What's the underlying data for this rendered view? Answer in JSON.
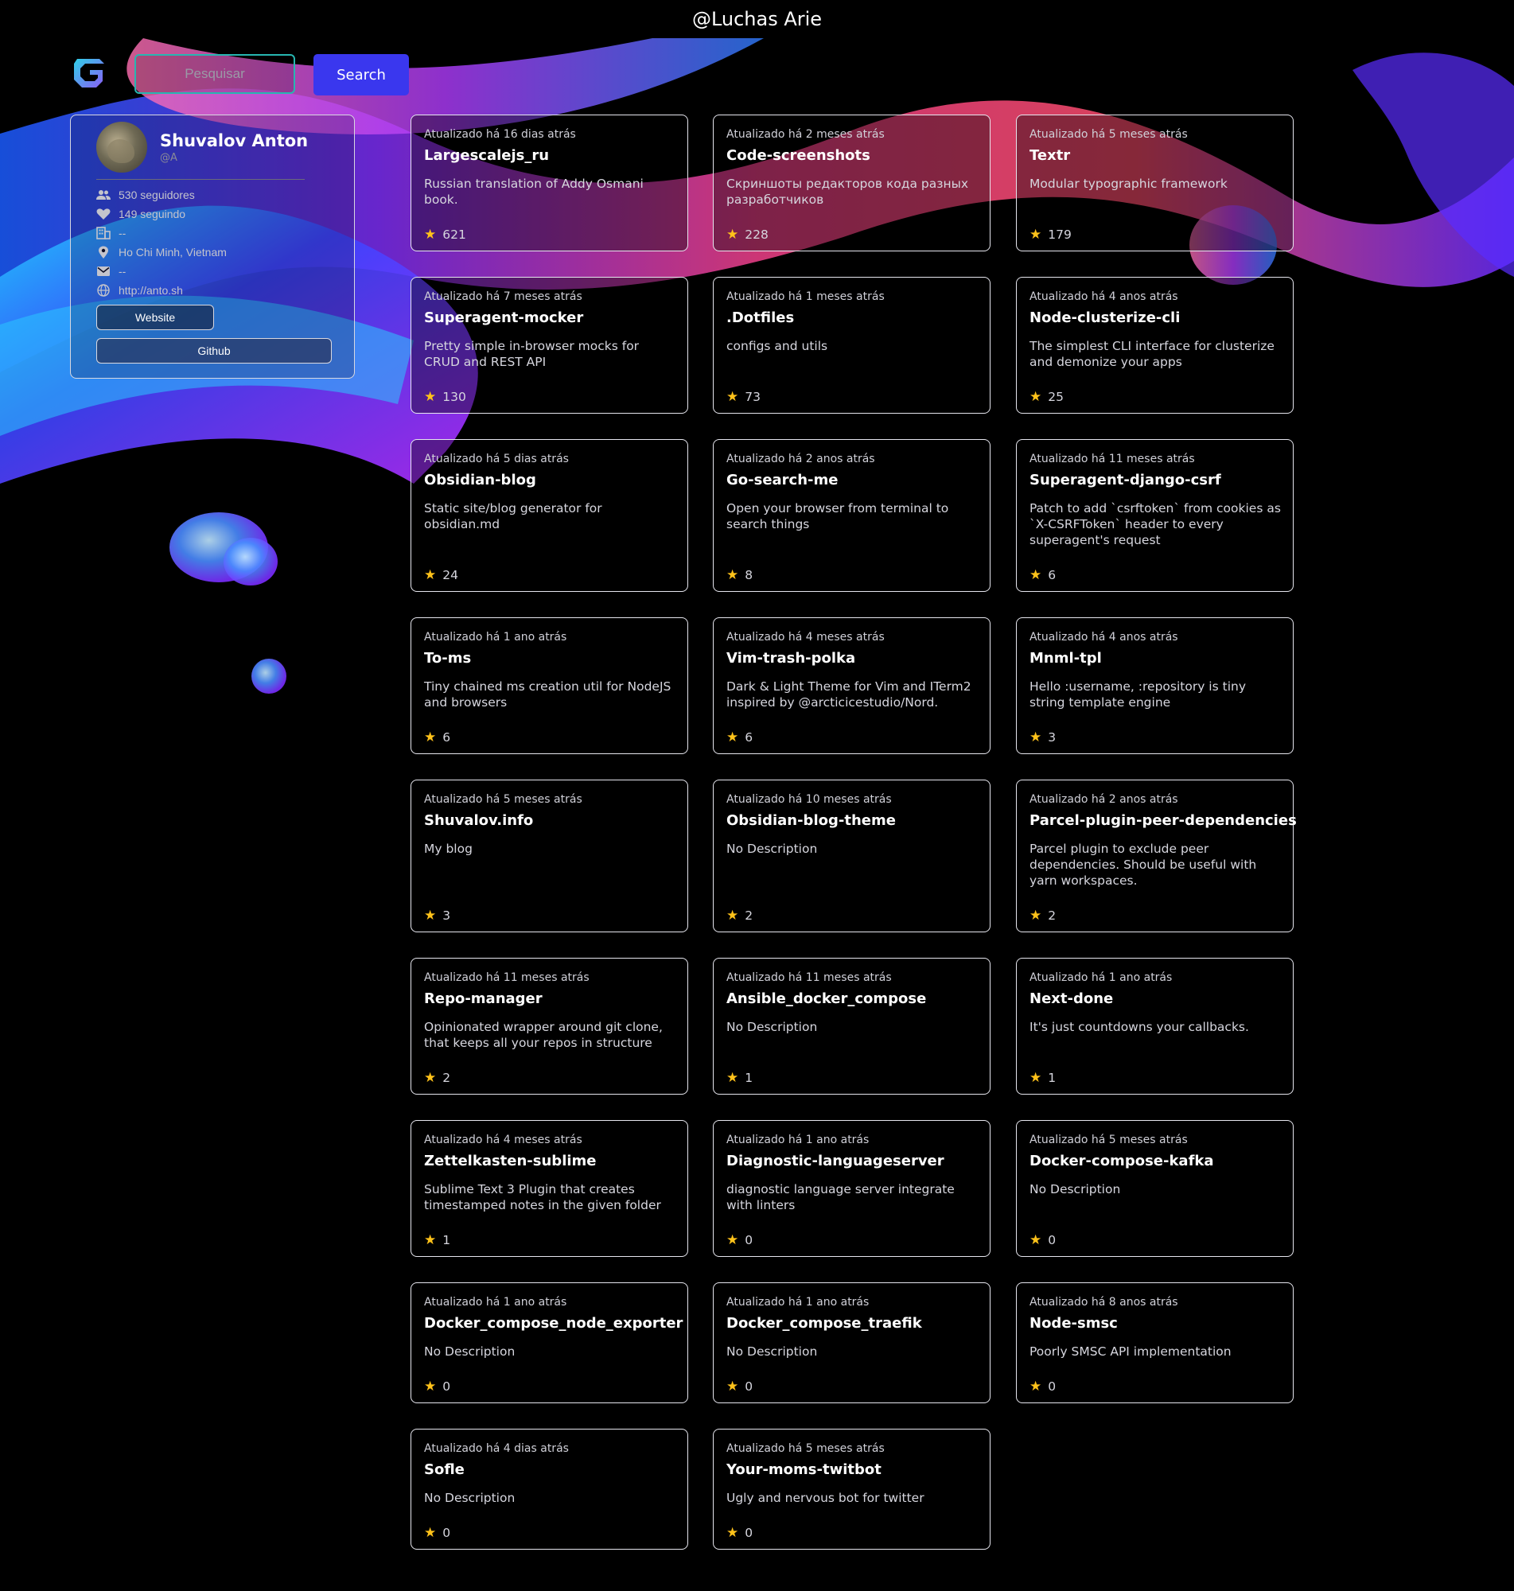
{
  "header": {
    "title": "@Luchas Arie"
  },
  "search": {
    "placeholder": "Pesquisar",
    "button_label": "Search"
  },
  "profile": {
    "name": "Shuvalov Anton",
    "handle": "@A",
    "info": [
      {
        "icon": "people-icon",
        "text": "530 seguidores"
      },
      {
        "icon": "heart-icon",
        "text": "149 seguindo"
      },
      {
        "icon": "building-icon",
        "text": "--"
      },
      {
        "icon": "location-pin-icon",
        "text": "Ho Chi Minh, Vietnam"
      },
      {
        "icon": "mail-icon",
        "text": "--"
      },
      {
        "icon": "globe-icon",
        "text": "http://anto.sh"
      }
    ],
    "website_label": "Website",
    "github_label": "Github"
  },
  "colors": {
    "accent": "#3a37ee",
    "input_border": "#27b6b1",
    "star": "#ffc21a"
  },
  "repos": [
    {
      "updated": "Atualizado há 16 dias atrás",
      "name": "Largescalejs_ru",
      "description": "Russian translation of Addy Osmani book.",
      "stars": "621"
    },
    {
      "updated": "Atualizado há 2 meses atrás",
      "name": "Code-screenshots",
      "description": "Скриншоты редакторов кода разных разработчиков",
      "stars": "228"
    },
    {
      "updated": "Atualizado há 5 meses atrás",
      "name": "Textr",
      "description": "Modular typographic framework",
      "stars": "179"
    },
    {
      "updated": "Atualizado há 7 meses atrás",
      "name": "Superagent-mocker",
      "description": "Pretty simple in-browser mocks for CRUD and REST API",
      "stars": "130"
    },
    {
      "updated": "Atualizado há 1 meses atrás",
      "name": ".Dotfiles",
      "description": "configs and utils",
      "stars": "73"
    },
    {
      "updated": "Atualizado há 4 anos atrás",
      "name": "Node-clusterize-cli",
      "description": "The simplest CLI interface for clusterize and demonize your apps",
      "stars": "25"
    },
    {
      "updated": "Atualizado há 5 dias atrás",
      "name": "Obsidian-blog",
      "description": "Static site/blog generator for obsidian.md",
      "stars": "24"
    },
    {
      "updated": "Atualizado há 2 anos atrás",
      "name": "Go-search-me",
      "description": "Open your browser from terminal to search things",
      "stars": "8"
    },
    {
      "updated": "Atualizado há 11 meses atrás",
      "name": "Superagent-django-csrf",
      "description": "Patch to add `csrftoken` from cookies as `X-CSRFToken` header to every superagent's request",
      "stars": "6"
    },
    {
      "updated": "Atualizado há 1 ano atrás",
      "name": "To-ms",
      "description": "Tiny chained ms creation util for NodeJS and browsers",
      "stars": "6"
    },
    {
      "updated": "Atualizado há 4 meses atrás",
      "name": "Vim-trash-polka",
      "description": "Dark & Light Theme for Vim and ITerm2 inspired by @arcticicestudio/Nord.",
      "stars": "6"
    },
    {
      "updated": "Atualizado há 4 anos atrás",
      "name": "Mnml-tpl",
      "description": "Hello :username, :repository is tiny string template engine",
      "stars": "3"
    },
    {
      "updated": "Atualizado há 5 meses atrás",
      "name": "Shuvalov.info",
      "description": "My blog",
      "stars": "3"
    },
    {
      "updated": "Atualizado há 10 meses atrás",
      "name": "Obsidian-blog-theme",
      "description": "No Description",
      "stars": "2"
    },
    {
      "updated": "Atualizado há 2 anos atrás",
      "name": "Parcel-plugin-peer-dependencies",
      "description": "Parcel plugin to exclude peer dependencies. Should be useful with yarn workspaces.",
      "stars": "2"
    },
    {
      "updated": "Atualizado há 11 meses atrás",
      "name": "Repo-manager",
      "description": "Opinionated wrapper around git clone, that keeps all your repos in structure",
      "stars": "2"
    },
    {
      "updated": "Atualizado há 11 meses atrás",
      "name": "Ansible_docker_compose",
      "description": "No Description",
      "stars": "1"
    },
    {
      "updated": "Atualizado há 1 ano atrás",
      "name": "Next-done",
      "description": "It's just countdowns your callbacks.",
      "stars": "1"
    },
    {
      "updated": "Atualizado há 4 meses atrás",
      "name": "Zettelkasten-sublime",
      "description": "Sublime Text 3 Plugin that creates timestamped notes in the given folder",
      "stars": "1"
    },
    {
      "updated": "Atualizado há 1 ano atrás",
      "name": "Diagnostic-languageserver",
      "description": "diagnostic language server integrate with linters",
      "stars": "0"
    },
    {
      "updated": "Atualizado há 5 meses atrás",
      "name": "Docker-compose-kafka",
      "description": "No Description",
      "stars": "0"
    },
    {
      "updated": "Atualizado há 1 ano atrás",
      "name": "Docker_compose_node_exporter",
      "description": "No Description",
      "stars": "0"
    },
    {
      "updated": "Atualizado há 1 ano atrás",
      "name": "Docker_compose_traefik",
      "description": "No Description",
      "stars": "0"
    },
    {
      "updated": "Atualizado há 8 anos atrás",
      "name": "Node-smsc",
      "description": "Poorly SMSC API implementation",
      "stars": "0"
    },
    {
      "updated": "Atualizado há 4 dias atrás",
      "name": "Sofle",
      "description": "No Description",
      "stars": "0"
    },
    {
      "updated": "Atualizado há 5 meses atrás",
      "name": "Your-moms-twitbot",
      "description": "Ugly and nervous bot for twitter",
      "stars": "0"
    }
  ]
}
